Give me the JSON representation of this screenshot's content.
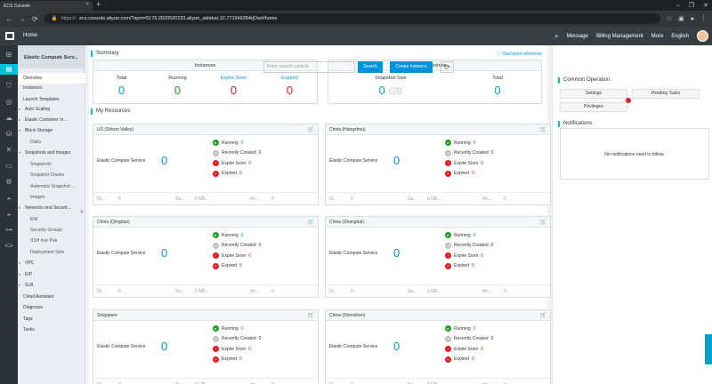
{
  "browser": {
    "tab_title": "ECS Console",
    "url_prefix": "https://",
    "url": "ecs.console.aliyun.com/?spm=5176.2020520153.aliyun_sidebar.12.771949284rjOw#/home"
  },
  "topnav": {
    "home": "Home",
    "message": "Message",
    "billing": "Billing Management",
    "more": "More",
    "language": "English"
  },
  "menu": {
    "header": "Elastic Compute Serv...",
    "items": [
      {
        "label": "Overview",
        "level": 0,
        "active": true,
        "arrow": false
      },
      {
        "label": "Instances",
        "level": 0,
        "arrow": false
      },
      {
        "label": "Launch Templates",
        "level": 0,
        "arrow": false
      },
      {
        "label": "Auto Scaling",
        "level": 0,
        "arrow": true
      },
      {
        "label": "Elastic Container In...",
        "level": 0,
        "arrow": true
      },
      {
        "label": "Block Storage",
        "level": 0,
        "arrow": true,
        "open": true
      },
      {
        "label": "Disks",
        "level": 1
      },
      {
        "label": "Snapshots and Images",
        "level": 0,
        "arrow": true,
        "open": true
      },
      {
        "label": "Snapshots",
        "level": 1
      },
      {
        "label": "Snapshot Chains",
        "level": 1
      },
      {
        "label": "Automatic Snapshot ...",
        "level": 1
      },
      {
        "label": "Images",
        "level": 1
      },
      {
        "label": "Networks and Securit...",
        "level": 0,
        "arrow": true,
        "open": true
      },
      {
        "label": "ENI",
        "level": 1
      },
      {
        "label": "Security Groups",
        "level": 1
      },
      {
        "label": "SSH Key Pair",
        "level": 1
      },
      {
        "label": "Deployment Sets",
        "level": 1
      },
      {
        "label": "VPC",
        "level": 0,
        "arrow": true
      },
      {
        "label": "EIP",
        "level": 0,
        "arrow": true
      },
      {
        "label": "SLB",
        "level": 0,
        "arrow": true
      },
      {
        "label": "Cloud Assistant",
        "level": 0
      },
      {
        "label": "Diagnosis",
        "level": 0
      },
      {
        "label": "Tags",
        "level": 0
      },
      {
        "label": "Tasks",
        "level": 0
      }
    ]
  },
  "summary": {
    "title": "Summary",
    "reference": "Operation reference",
    "instances": {
      "header": "Instances",
      "total_label": "Total",
      "total": "0",
      "running_label": "Running",
      "running": "0",
      "expire_label": "Expire Soon",
      "expire": "0",
      "expired_label": "Expired",
      "expired": "0"
    },
    "snapshots": {
      "header": "Snapshots",
      "size_label": "Snapshot Size",
      "size": "0",
      "size_unit": "GB",
      "total_label": "Total",
      "total": "0"
    }
  },
  "resources": {
    "title": "My Resources",
    "search_placeholder": "Enter search content",
    "search_button": "Search",
    "create_button": "Create Instance"
  },
  "card_labels": {
    "ecs": "Elastic Compute Service",
    "running": "Running",
    "recent": "Recently Created",
    "expire": "Expire Soon",
    "expired": "Expired",
    "foot1": "Di...",
    "foot2": "0",
    "foot3": "Sa...",
    "foot4": "0 GB...",
    "foot5": "Im...",
    "foot6": "0"
  },
  "regions": [
    {
      "name": "US (Silicon Valley)",
      "count": "0",
      "running": "0",
      "recent": "0",
      "expire": "0",
      "expired": "0"
    },
    {
      "name": "China (Hangzhou)",
      "count": "0",
      "running": "0",
      "recent": "0",
      "expire": "0",
      "expired": "0"
    },
    {
      "name": "China (Qingdao)",
      "count": "0",
      "running": "0",
      "recent": "0",
      "expire": "0",
      "expired": "0"
    },
    {
      "name": "China (Shanghai)",
      "count": "0",
      "running": "0",
      "recent": "0",
      "expire": "0",
      "expired": "0"
    },
    {
      "name": "Singapore",
      "count": "0",
      "running": "0",
      "recent": "0",
      "expire": "0",
      "expired": "0"
    },
    {
      "name": "China (Shenzhen)",
      "count": "0",
      "running": "0",
      "recent": "0",
      "expire": "0",
      "expired": "0"
    }
  ],
  "card_foot_alt": {
    "foot5": "Sn...",
    "foot3": "Sa..."
  },
  "right": {
    "common": "Common Operation",
    "settings": "Settings",
    "pending": "Pending Tasks",
    "privileges": "Privileges",
    "notifications": "Notifications",
    "no_notif": "No notifications need to follow."
  },
  "colors": {
    "accent": "#00c1de",
    "blue": "#0093dd",
    "green": "#1e9f1e",
    "red": "#e7191f"
  }
}
